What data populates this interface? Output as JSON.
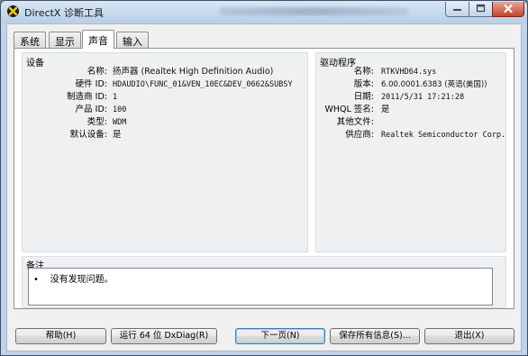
{
  "window": {
    "title": "DirectX 诊断工具"
  },
  "tabs": [
    {
      "label": "系统"
    },
    {
      "label": "显示"
    },
    {
      "label": "声音",
      "active": true
    },
    {
      "label": "输入"
    }
  ],
  "device": {
    "section_title": "设备",
    "rows": [
      {
        "label": "名称:",
        "value": "扬声器 (Realtek High Definition Audio)"
      },
      {
        "label": "硬件 ID:",
        "value": "HDAUDIO\\FUNC_01&VEN_10EC&DEV_0662&SUBSYS_"
      },
      {
        "label": "制造商 ID:",
        "value": "1"
      },
      {
        "label": "产品 ID:",
        "value": "100"
      },
      {
        "label": "类型:",
        "value": "WDM"
      },
      {
        "label": "默认设备:",
        "value": "是"
      }
    ]
  },
  "driver": {
    "section_title": "驱动程序",
    "rows": [
      {
        "label": "名称:",
        "value": "RTKVHD64.sys"
      },
      {
        "label": "版本:",
        "value": "6.00.0001.6383 (英语(美国))"
      },
      {
        "label": "日期:",
        "value": "2011/5/31 17:21:28"
      },
      {
        "label": "WHQL 签名:",
        "value": "是"
      },
      {
        "label": "其他文件:",
        "value": ""
      },
      {
        "label": "供应商:",
        "value": "Realtek Semiconductor Corp."
      }
    ]
  },
  "notes": {
    "section_title": "备注",
    "items": [
      "没有发现问题。"
    ]
  },
  "buttons": {
    "help": "帮助(H)",
    "run64": "运行 64 位 DxDiag(R)",
    "next": "下一页(N)",
    "save": "保存所有信息(S)...",
    "exit": "退出(X)"
  }
}
